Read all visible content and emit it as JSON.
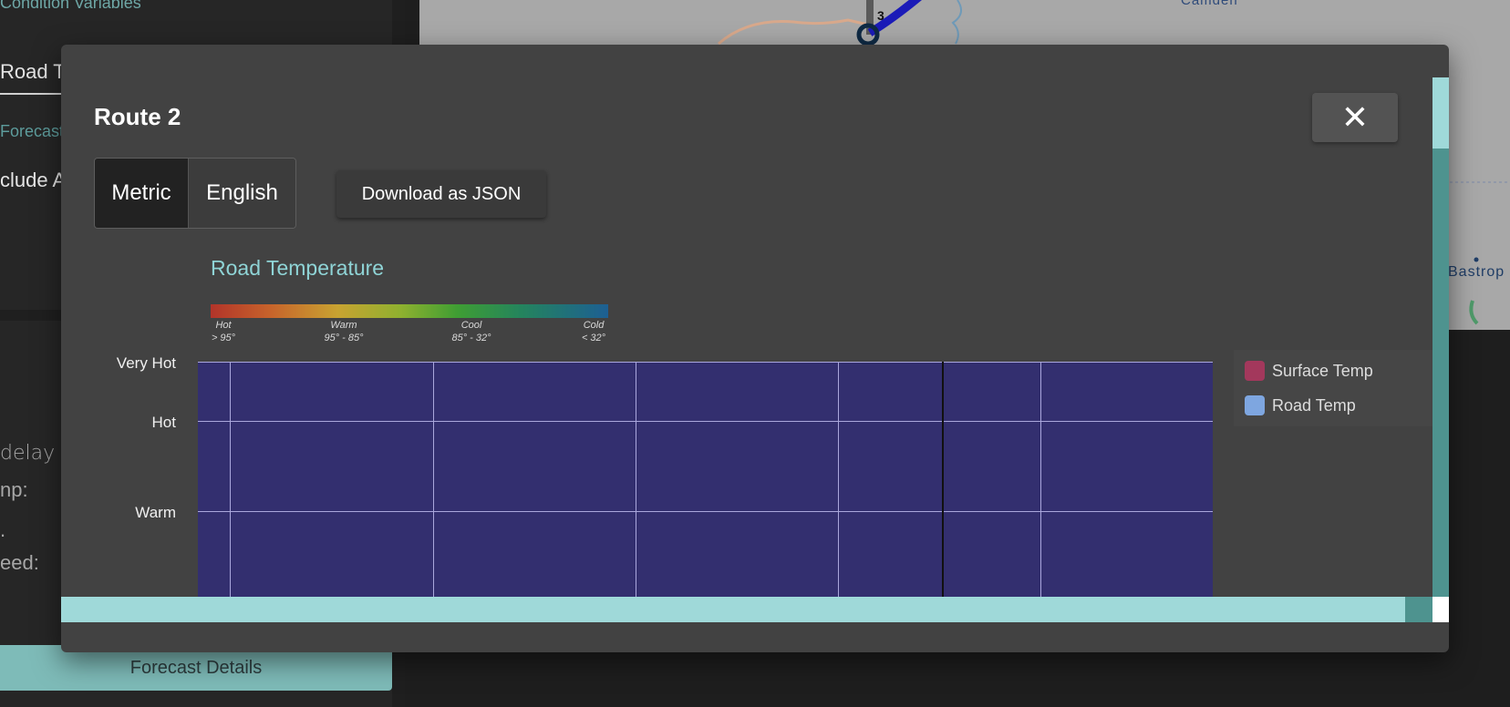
{
  "background": {
    "condition_variables": "Condition Variables",
    "road_tab": "Road T",
    "forecast_label": "Forecast",
    "include_label": "clude A",
    "delay_label": "delay n",
    "temp_label": "np:",
    "dot_label": ".",
    "speed_label": "eed:",
    "forecast_details_button": "Forecast Details",
    "map_town_camden": "Camden",
    "map_town_bastrop": "Bastrop",
    "map_marker_number": "3"
  },
  "modal": {
    "title": "Route 2",
    "close_icon": "✕",
    "units": {
      "metric": "Metric",
      "english": "English",
      "selected": "Metric"
    },
    "download_button": "Download as JSON"
  },
  "colors": {
    "chart_background": "#332f6f",
    "surface_temp": "#a3385c",
    "road_temp": "#7ea6e0",
    "accent": "#8fd4d6"
  },
  "chart_data": {
    "type": "line",
    "title": "Road Temperature",
    "scale_legend": [
      {
        "label": "Hot",
        "range": "> 95°"
      },
      {
        "label": "Warm",
        "range": "95° - 85°"
      },
      {
        "label": "Cool",
        "range": "85° - 32°"
      },
      {
        "label": "Cold",
        "range": "< 32°"
      }
    ],
    "y_categories": [
      "Very Hot",
      "Hot",
      "Warm"
    ],
    "series": [
      {
        "name": "Surface Temp",
        "color": "#a3385c",
        "values": []
      },
      {
        "name": "Road Temp",
        "color": "#7ea6e0",
        "values": []
      }
    ],
    "grid": true,
    "legend_position": "right"
  }
}
